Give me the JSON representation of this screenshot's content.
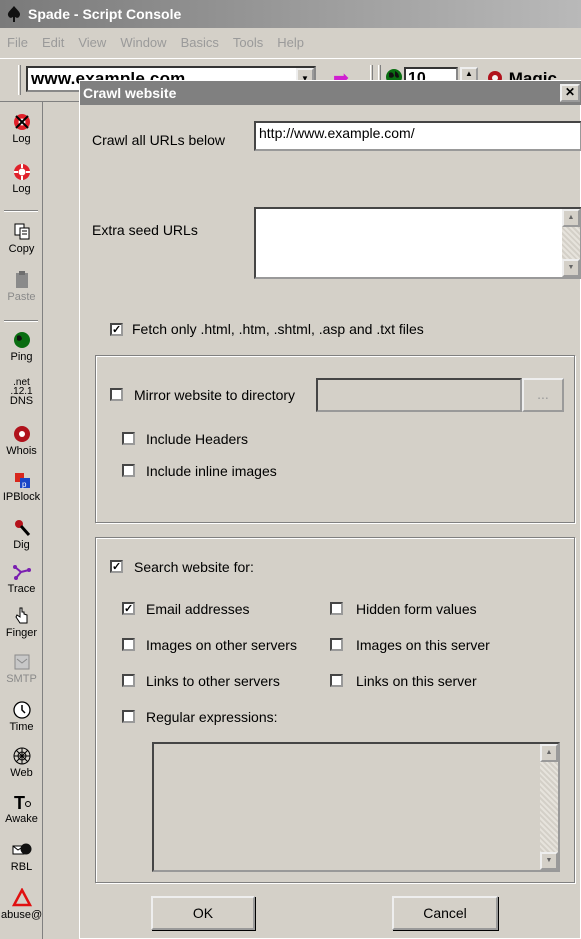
{
  "window": {
    "title": "Spade - Script Console"
  },
  "menu": [
    "File",
    "Edit",
    "View",
    "Window",
    "Basics",
    "Tools",
    "Help"
  ],
  "toolbar": {
    "url_value": "www.example.com",
    "count_value": "10",
    "magic_label": "Magic"
  },
  "sidebar": [
    {
      "label": "Log",
      "icon": "log-clear-icon"
    },
    {
      "label": "Log",
      "icon": "log-icon"
    },
    {
      "label": "Copy",
      "icon": "copy-icon"
    },
    {
      "label": "Paste",
      "icon": "paste-icon",
      "disabled": true
    },
    {
      "label": "Ping",
      "icon": "ping-icon"
    },
    {
      "label": "DNS",
      "icon": "dns-icon",
      "sub": ".net .12.1"
    },
    {
      "label": "Whois",
      "icon": "whois-icon"
    },
    {
      "label": "IPBlock",
      "icon": "ipblock-icon"
    },
    {
      "label": "Dig",
      "icon": "dig-icon"
    },
    {
      "label": "Trace",
      "icon": "trace-icon"
    },
    {
      "label": "Finger",
      "icon": "finger-icon"
    },
    {
      "label": "SMTP",
      "icon": "smtp-icon",
      "disabled": true
    },
    {
      "label": "Time",
      "icon": "time-icon"
    },
    {
      "label": "Web",
      "icon": "web-icon"
    },
    {
      "label": "Awake",
      "icon": "awake-icon"
    },
    {
      "label": "RBL",
      "icon": "rbl-icon"
    },
    {
      "label": "abuse@",
      "icon": "abuse-icon"
    }
  ],
  "dialog": {
    "title": "Crawl website",
    "crawl_label": "Crawl all URLs below",
    "crawl_value": "http://www.example.com/",
    "seed_label": "Extra seed URLs",
    "seed_value": "",
    "fetch_only": {
      "label": "Fetch only .html, .htm, .shtml, .asp and .txt files",
      "checked": true
    },
    "mirror": {
      "label": "Mirror website to directory",
      "checked": false,
      "value": "",
      "browse_label": "..."
    },
    "include_headers": {
      "label": "Include Headers",
      "checked": false
    },
    "include_images": {
      "label": "Include inline images",
      "checked": false
    },
    "search": {
      "label": "Search website for:",
      "checked": true
    },
    "options": {
      "email": {
        "label": "Email addresses",
        "checked": true
      },
      "hidden": {
        "label": "Hidden form values",
        "checked": false
      },
      "img_other": {
        "label": "Images on other servers",
        "checked": false
      },
      "img_this": {
        "label": "Images on this server",
        "checked": false
      },
      "links_other": {
        "label": "Links to other servers",
        "checked": false
      },
      "links_this": {
        "label": "Links on this server",
        "checked": false
      },
      "regex": {
        "label": "Regular expressions:",
        "checked": false
      }
    },
    "regex_value": "",
    "ok_label": "OK",
    "cancel_label": "Cancel"
  }
}
